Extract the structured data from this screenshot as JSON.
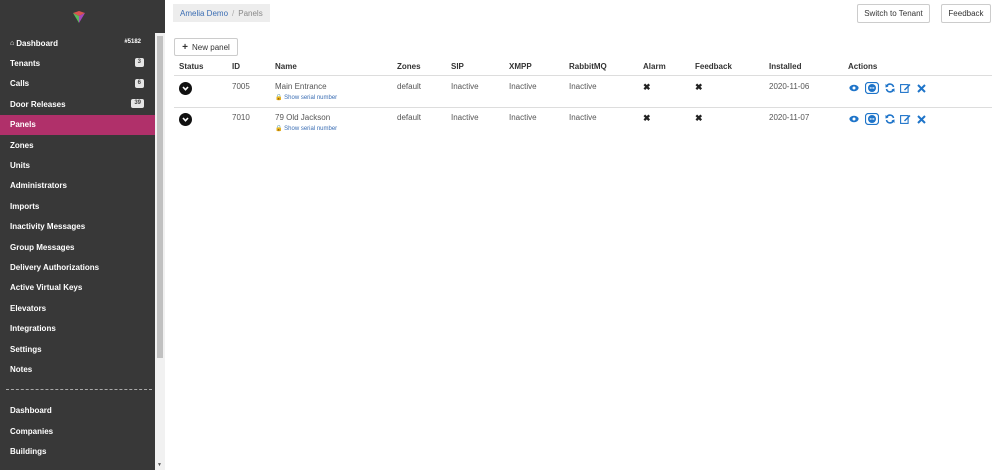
{
  "colors": {
    "sidebar": "#383838",
    "active": "#b0306a",
    "link": "#3a6db3",
    "action": "#1e74c9"
  },
  "sidebar": {
    "items": [
      {
        "label": "Dashboard",
        "count": "#5182",
        "icon": "home-icon"
      },
      {
        "label": "Tenants",
        "badge": "3"
      },
      {
        "label": "Calls",
        "badge": "6"
      },
      {
        "label": "Door Releases",
        "badge": "39"
      },
      {
        "label": "Panels",
        "active": true
      },
      {
        "label": "Zones"
      },
      {
        "label": "Units"
      },
      {
        "label": "Administrators"
      },
      {
        "label": "Imports"
      },
      {
        "label": "Inactivity Messages"
      },
      {
        "label": "Group Messages"
      },
      {
        "label": "Delivery Authorizations"
      },
      {
        "label": "Active Virtual Keys"
      },
      {
        "label": "Elevators"
      },
      {
        "label": "Integrations"
      },
      {
        "label": "Settings"
      },
      {
        "label": "Notes"
      }
    ],
    "bottom_items": [
      {
        "label": "Dashboard"
      },
      {
        "label": "Companies"
      },
      {
        "label": "Buildings"
      }
    ]
  },
  "breadcrumb": {
    "parent": "Amelia Demo",
    "separator": "/",
    "current": "Panels"
  },
  "header_buttons": {
    "switch_tenant": "Switch to Tenant",
    "feedback": "Feedback"
  },
  "toolbar": {
    "new_panel": "New panel",
    "new_panel_icon": "plus-icon"
  },
  "table": {
    "columns": [
      "Status",
      "ID",
      "Name",
      "Zones",
      "SIP",
      "XMPP",
      "RabbitMQ",
      "Alarm",
      "Feedback",
      "Installed",
      "Actions"
    ],
    "rows": [
      {
        "status_icon": "chevron-down-circle-icon",
        "id": "7005",
        "name": "Main Entrance",
        "serial_link": "Show serial number",
        "zones": "default",
        "sip": "Inactive",
        "xmpp": "Inactive",
        "rabbitmq": "Inactive",
        "alarm": "✖",
        "feedback": "✖",
        "installed": "2020-11-06"
      },
      {
        "status_icon": "chevron-down-circle-icon",
        "id": "7010",
        "name": "79 Old Jackson",
        "serial_link": "Show serial number",
        "zones": "default",
        "sip": "Inactive",
        "xmpp": "Inactive",
        "rabbitmq": "Inactive",
        "alarm": "✖",
        "feedback": "✖",
        "installed": "2020-11-07"
      }
    ],
    "action_icons": [
      "eye-icon",
      "chat-bubble-icon",
      "refresh-icon",
      "edit-icon",
      "close-icon"
    ]
  }
}
